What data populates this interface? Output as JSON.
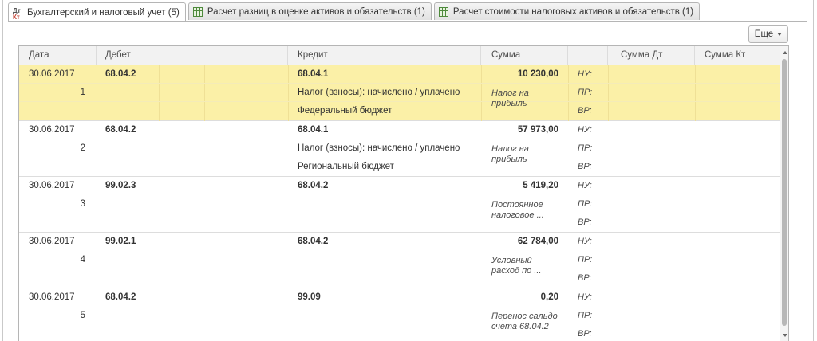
{
  "tabs": [
    {
      "label": "Бухгалтерский и налоговый учет (5)",
      "icon": "dt-kt-icon",
      "active": true
    },
    {
      "label": "Расчет разниц в оценке активов и обязательств (1)",
      "icon": "table-icon",
      "active": false
    },
    {
      "label": "Расчет стоимости налоговых активов и обязательств (1)",
      "icon": "table-icon",
      "active": false
    }
  ],
  "toolbar": {
    "more_label": "Еще"
  },
  "columns": {
    "date": "Дата",
    "debit": "Дебет",
    "credit": "Кредит",
    "sum": "Сумма",
    "type": "",
    "sum_dt": "Сумма Дт",
    "sum_kt": "Сумма Кт"
  },
  "rows": [
    {
      "date": "30.06.2017",
      "num": "1",
      "debit": "68.04.2",
      "credit": "68.04.1",
      "credit2": "Налог (взносы): начислено / уплачено",
      "credit3": "Федеральный бюджет",
      "sum": "10 230,00",
      "content": "Налог на прибыль",
      "nu": "НУ:",
      "pr": "ПР:",
      "vr": "ВР:"
    },
    {
      "date": "30.06.2017",
      "num": "2",
      "debit": "68.04.2",
      "credit": "68.04.1",
      "credit2": "Налог (взносы): начислено / уплачено",
      "credit3": "Региональный бюджет",
      "sum": "57 973,00",
      "content": "Налог на прибыль",
      "nu": "НУ:",
      "pr": "ПР:",
      "vr": "ВР:"
    },
    {
      "date": "30.06.2017",
      "num": "3",
      "debit": "99.02.3",
      "credit": "68.04.2",
      "credit2": "",
      "credit3": "",
      "sum": "5 419,20",
      "content": "Постоянное налоговое ...",
      "nu": "НУ:",
      "pr": "ПР:",
      "vr": "ВР:"
    },
    {
      "date": "30.06.2017",
      "num": "4",
      "debit": "99.02.1",
      "credit": "68.04.2",
      "credit2": "",
      "credit3": "",
      "sum": "62 784,00",
      "content": "Условный расход по ...",
      "nu": "НУ:",
      "pr": "ПР:",
      "vr": "ВР:"
    },
    {
      "date": "30.06.2017",
      "num": "5",
      "debit": "68.04.2",
      "credit": "99.09",
      "credit2": "",
      "credit3": "",
      "sum": "0,20",
      "content": "Перенос сальдо счета 68.04.2",
      "nu": "НУ:",
      "pr": "ПР:",
      "vr": "ВР:"
    }
  ],
  "colors": {
    "selected_row": "#fbf0a7",
    "header_bg": "#f2f2f2"
  }
}
